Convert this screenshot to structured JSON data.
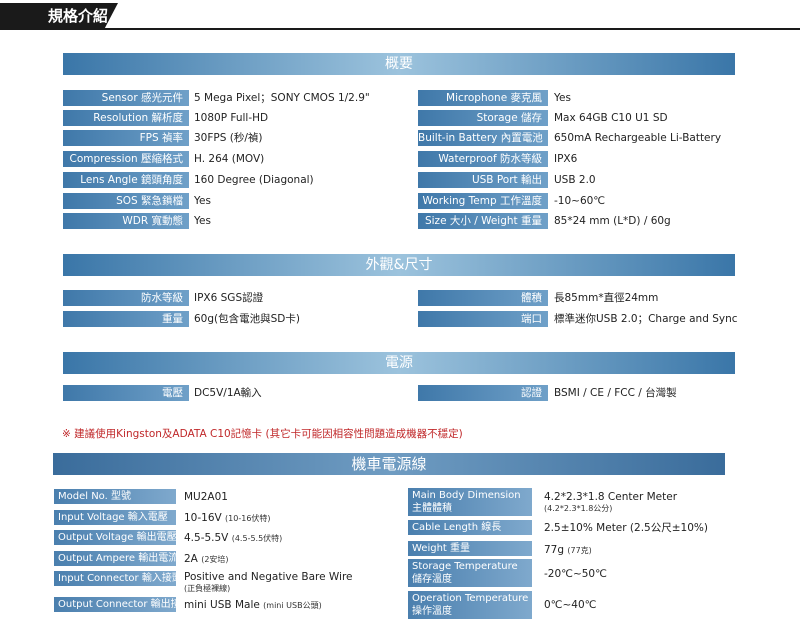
{
  "title": "規格介紹",
  "sections": {
    "overview": "概要",
    "appearance": "外觀&尺寸",
    "power": "電源",
    "cable": "機車電源線"
  },
  "overview_left": [
    {
      "label": "Sensor 感光元件",
      "value": "5 Mega Pixel；SONY CMOS 1/2.9\""
    },
    {
      "label": "Resolution 解析度",
      "value": "1080P Full-HD"
    },
    {
      "label": "FPS  禎率",
      "value": "30FPS (秒/禎)"
    },
    {
      "label": "Compression  壓縮格式",
      "value": "H. 264 (MOV)"
    },
    {
      "label": "Lens Angle 鏡頭角度",
      "value": "160 Degree (Diagonal)"
    },
    {
      "label": "SOS 緊急鎖檔",
      "value": "Yes"
    },
    {
      "label": "WDR 寬動態",
      "value": "Yes"
    }
  ],
  "overview_right": [
    {
      "label": "Microphone 麥克風",
      "value": "Yes"
    },
    {
      "label": "Storage 儲存",
      "value": "Max 64GB C10 U1 SD"
    },
    {
      "label": "Built-in Battery 內置電池",
      "value": "650mA Rechargeable Li-Battery"
    },
    {
      "label": "Waterproof 防水等級",
      "value": "IPX6"
    },
    {
      "label": "USB Port 輸出",
      "value": "USB 2.0"
    },
    {
      "label": "Working Temp 工作溫度",
      "value": "-10~60℃"
    },
    {
      "label": "Size 大小 / Weight 重量",
      "value": "85*24 mm (L*D) /  60g"
    }
  ],
  "appearance_left": [
    {
      "label": "防水等級",
      "value": "IPX6 SGS認證"
    },
    {
      "label": "重量",
      "value": "60g(包含電池與SD卡)"
    }
  ],
  "appearance_right": [
    {
      "label": "體積",
      "value": "長85mm*直徑24mm"
    },
    {
      "label": "端口",
      "value": "標準迷你USB 2.0；Charge and Sync"
    }
  ],
  "power_left": {
    "label": "電壓",
    "value": "DC5V/1A輸入"
  },
  "power_right": {
    "label": "認證",
    "value": "BSMI / CE / FCC / 台灣製"
  },
  "note": "※ 建議使用Kingston及ADATA C10記憶卡 (其它卡可能因相容性問題造成機器不穩定)",
  "cable_left": [
    {
      "label": "Model No. 型號",
      "value": "MU2A01",
      "small": "",
      "sub": ""
    },
    {
      "label": "Input Voltage 輸入電壓",
      "value": "10-16V",
      "small": "(10-16伏特)",
      "sub": ""
    },
    {
      "label": "Output Voltage 輸出電壓",
      "value": "4.5-5.5V",
      "small": "(4.5-5.5伏特)",
      "sub": ""
    },
    {
      "label": "Output Ampere 輸出電流",
      "value": "2A",
      "small": "(2安培)",
      "sub": ""
    },
    {
      "label": "Input Connector 輸入接頭",
      "value": "Positive and Negative Bare Wire",
      "small": "",
      "sub": "(正負極裸線)"
    },
    {
      "label": "Output Connector 輸出接頭",
      "value": "mini USB Male",
      "small": "(mini USB公頭)",
      "sub": ""
    }
  ],
  "cable_right": [
    {
      "label1": "Main Body Dimension",
      "label2": "主體體積",
      "value": "4.2*2.3*1.8 Center Meter",
      "small": "",
      "sub": "(4.2*2.3*1.8公分)"
    },
    {
      "label1": "Cable Length  線長",
      "label2": "",
      "value": "2.5±10% Meter (2.5公尺±10%)",
      "small": "",
      "sub": ""
    },
    {
      "label1": "Weight 重量",
      "label2": "",
      "value": "77g",
      "small": "(77克)",
      "sub": ""
    },
    {
      "label1": "Storage Temperature",
      "label2": "儲存溫度",
      "value": "-20℃~50℃",
      "small": "",
      "sub": ""
    },
    {
      "label1": "Operation Temperature",
      "label2": "操作溫度",
      "value": "0℃~40℃",
      "small": "",
      "sub": ""
    }
  ]
}
